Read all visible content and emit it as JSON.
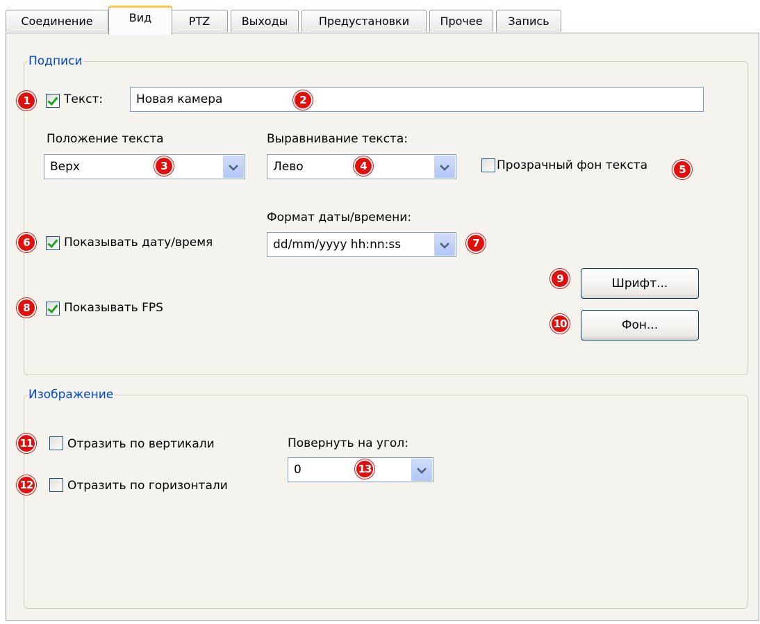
{
  "tabs": [
    "Соединение",
    "Вид",
    "PTZ",
    "Выходы",
    "Предустановки",
    "Прочее",
    "Запись"
  ],
  "captions_group": {
    "legend": "Подписи",
    "text_checkbox": {
      "label": "Текст:",
      "checked": true
    },
    "text_value": "Новая камера",
    "text_position": {
      "label": "Положение текста",
      "value": "Верх"
    },
    "text_alignment": {
      "label": "Выравнивание текста:",
      "value": "Лево"
    },
    "transparent_bg": {
      "label": "Прозрачный фон текста",
      "checked": false
    },
    "show_datetime": {
      "label": "Показывать дату/время",
      "checked": true
    },
    "datetime_format": {
      "label": "Формат даты/времени:",
      "value": "dd/mm/yyyy hh:nn:ss"
    },
    "show_fps": {
      "label": "Показывать FPS",
      "checked": true
    },
    "font_button": "Шрифт...",
    "background_button": "Фон..."
  },
  "image_group": {
    "legend": "Изображение",
    "flip_vertical": {
      "label": "Отразить по вертикали",
      "checked": false
    },
    "flip_horizontal": {
      "label": "Отразить по горизонтали",
      "checked": false
    },
    "rotate": {
      "label": "Повернуть на угол:",
      "value": "0"
    }
  },
  "markers": [
    "1",
    "2",
    "3",
    "4",
    "5",
    "6",
    "7",
    "8",
    "9",
    "10",
    "11",
    "12",
    "13"
  ],
  "colors": {
    "legend": "#0046d5",
    "marker": "#e0100d",
    "active_tab_accent": "#ffc83c"
  }
}
